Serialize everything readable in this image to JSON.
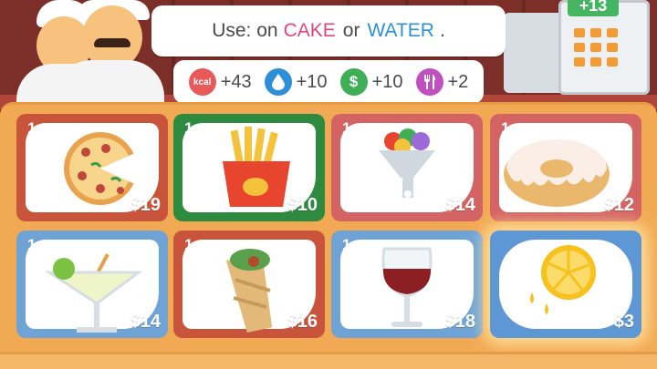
{
  "tip": {
    "prefix": "Use: on",
    "cake": "CAKE",
    "or": "or",
    "water": "WATER",
    "suffix": "."
  },
  "register": {
    "plus": "+13"
  },
  "stats": [
    {
      "icon": "kcal-icon",
      "icon_text": "kcal",
      "value": "+43",
      "color": "#e85a5a"
    },
    {
      "icon": "water-drop-icon",
      "value": "+10",
      "color": "#2d8fd8"
    },
    {
      "icon": "money-icon",
      "icon_text": "$",
      "value": "+10",
      "color": "#3fae56"
    },
    {
      "icon": "fork-knife-icon",
      "value": "+2",
      "color": "#c04fc0"
    }
  ],
  "items": [
    {
      "name": "pizza",
      "qty": "1",
      "price": "$19"
    },
    {
      "name": "fries",
      "qty": "1",
      "price": "$10"
    },
    {
      "name": "ice-cream",
      "qty": "1",
      "price": "$14"
    },
    {
      "name": "donut",
      "qty": "1",
      "price": "$12"
    },
    {
      "name": "cocktail",
      "qty": "1",
      "price": "$14"
    },
    {
      "name": "burrito",
      "qty": "1",
      "price": "$16"
    },
    {
      "name": "wine",
      "qty": "1",
      "price": "$18"
    },
    {
      "name": "lemon",
      "qty": "",
      "price": "$3"
    }
  ]
}
